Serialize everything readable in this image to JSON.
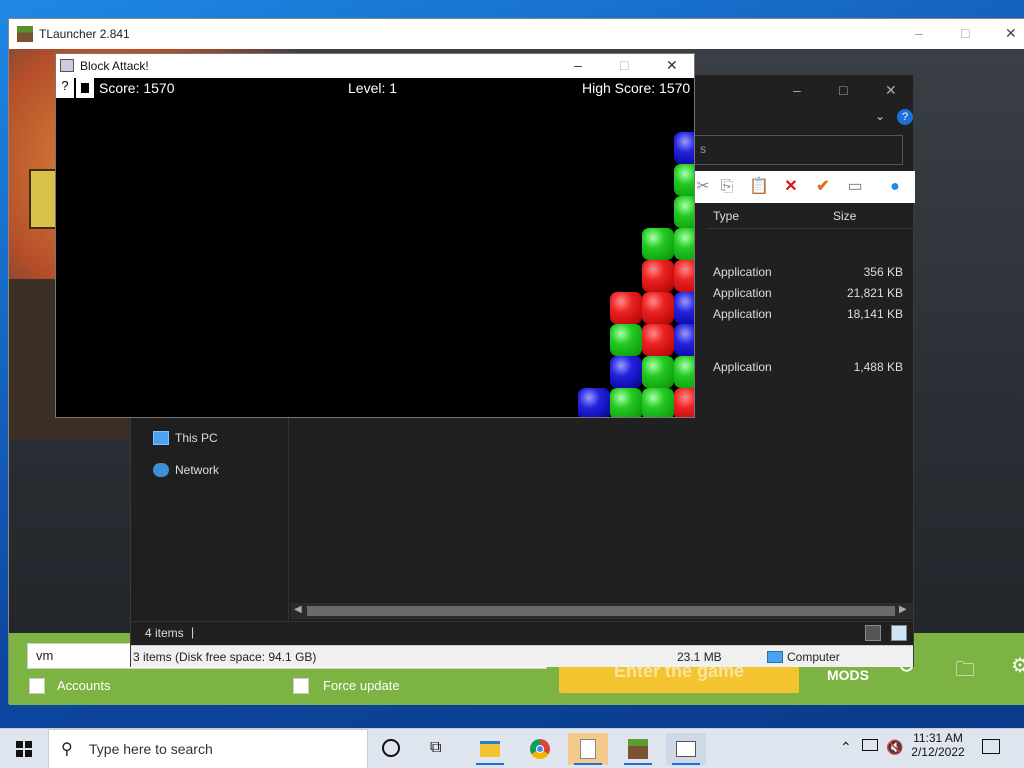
{
  "tlauncher": {
    "title": "TLauncher 2.841",
    "username_value": "vm",
    "accounts_label": "Accounts",
    "force_update_label": "Force update",
    "enter_button": "Enter the game",
    "mods_label": "MODS",
    "brand_color": "#7cb342",
    "button_color": "#f4c430"
  },
  "explorer": {
    "search_fragment": "s",
    "columns": {
      "type": "Type",
      "size": "Size"
    },
    "rows": [
      {
        "type": "Application",
        "size": "356 KB"
      },
      {
        "type": "Application",
        "size": "21,821 KB"
      },
      {
        "type": "Application",
        "size": "18,141 KB"
      },
      {
        "type": "Application",
        "size": "1,488 KB"
      }
    ],
    "nav": [
      {
        "label": "This PC",
        "icon": "computer-icon"
      },
      {
        "label": "Network",
        "icon": "network-icon"
      }
    ],
    "status_items": "4 items",
    "status_selected": "3 items (Disk free space: 94.1 GB)",
    "status_size": "23.1 MB",
    "status_location": "Computer"
  },
  "block_attack": {
    "title": "Block Attack!",
    "help_label": "?",
    "score": "Score: 1570",
    "level": "Level: 1",
    "high_score": "High Score: 1570"
  },
  "taskbar": {
    "search_placeholder": "Type here to search",
    "time": "11:31 AM",
    "date": "2/12/2022",
    "apps": [
      "task-view-icon",
      "file-explorer-icon",
      "chrome-icon",
      "java-icon",
      "minecraft-icon",
      "block-attack-icon"
    ]
  }
}
